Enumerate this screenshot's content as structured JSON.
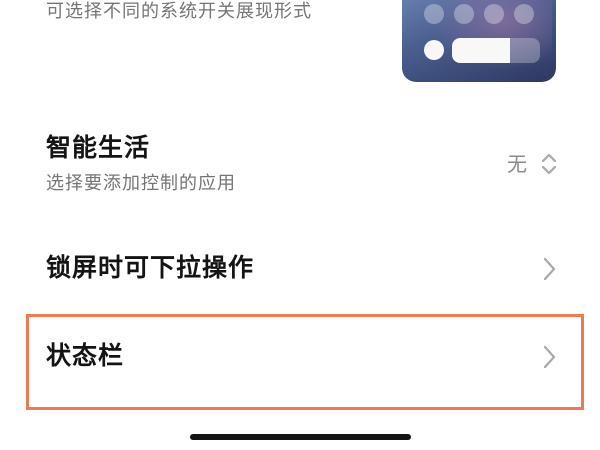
{
  "settings": {
    "display_style": {
      "subtitle": "可选择不同的系统开关展现形式"
    },
    "smart_life": {
      "title": "智能生活",
      "subtitle": "选择要添加控制的应用",
      "value": "无"
    },
    "lockscreen_pulldown": {
      "title": "锁屏时可下拉操作"
    },
    "status_bar": {
      "title": "状态栏"
    }
  },
  "colors": {
    "highlight_border": "#ef7a4f",
    "secondary_text": "#757575",
    "chevron": "#a8a8a8"
  },
  "icons": {
    "chevron": "chevron-right-icon",
    "selector": "chevron-up-down-icon"
  }
}
